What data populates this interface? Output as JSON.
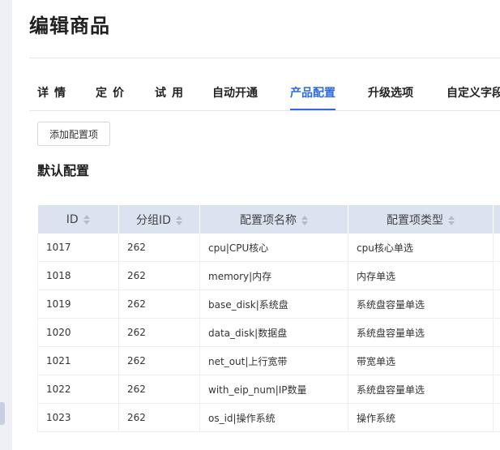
{
  "page": {
    "title": "编辑商品"
  },
  "tabs": [
    {
      "label": "详情",
      "active": false
    },
    {
      "label": "定价",
      "active": false
    },
    {
      "label": "试用",
      "active": false
    },
    {
      "label": "自动开通",
      "active": false
    },
    {
      "label": "产品配置",
      "active": true
    },
    {
      "label": "升级选项",
      "active": false
    },
    {
      "label": "自定义字段",
      "active": false
    }
  ],
  "toolbar": {
    "add_label": "添加配置项"
  },
  "section": {
    "title": "默认配置"
  },
  "table": {
    "columns": [
      "ID",
      "分组ID",
      "配置项名称",
      "配置项类型",
      ""
    ],
    "rows": [
      [
        "1017",
        "262",
        "cpu|CPU核心",
        "cpu核心单选",
        ""
      ],
      [
        "1018",
        "262",
        "memory|内存",
        "内存单选",
        ""
      ],
      [
        "1019",
        "262",
        "base_disk|系统盘",
        "系统盘容量单选",
        ""
      ],
      [
        "1020",
        "262",
        "data_disk|数据盘",
        "系统盘容量单选",
        ""
      ],
      [
        "1021",
        "262",
        "net_out|上行宽带",
        "带宽单选",
        ""
      ],
      [
        "1022",
        "262",
        "with_eip_num|IP数量",
        "系统盘容量单选",
        ""
      ],
      [
        "1023",
        "262",
        "os_id|操作系统",
        "操作系统",
        ""
      ]
    ]
  },
  "colors": {
    "accent": "#2d6be4",
    "header_bg": "#dbe3f1",
    "sidebar": "#eef0f5"
  }
}
